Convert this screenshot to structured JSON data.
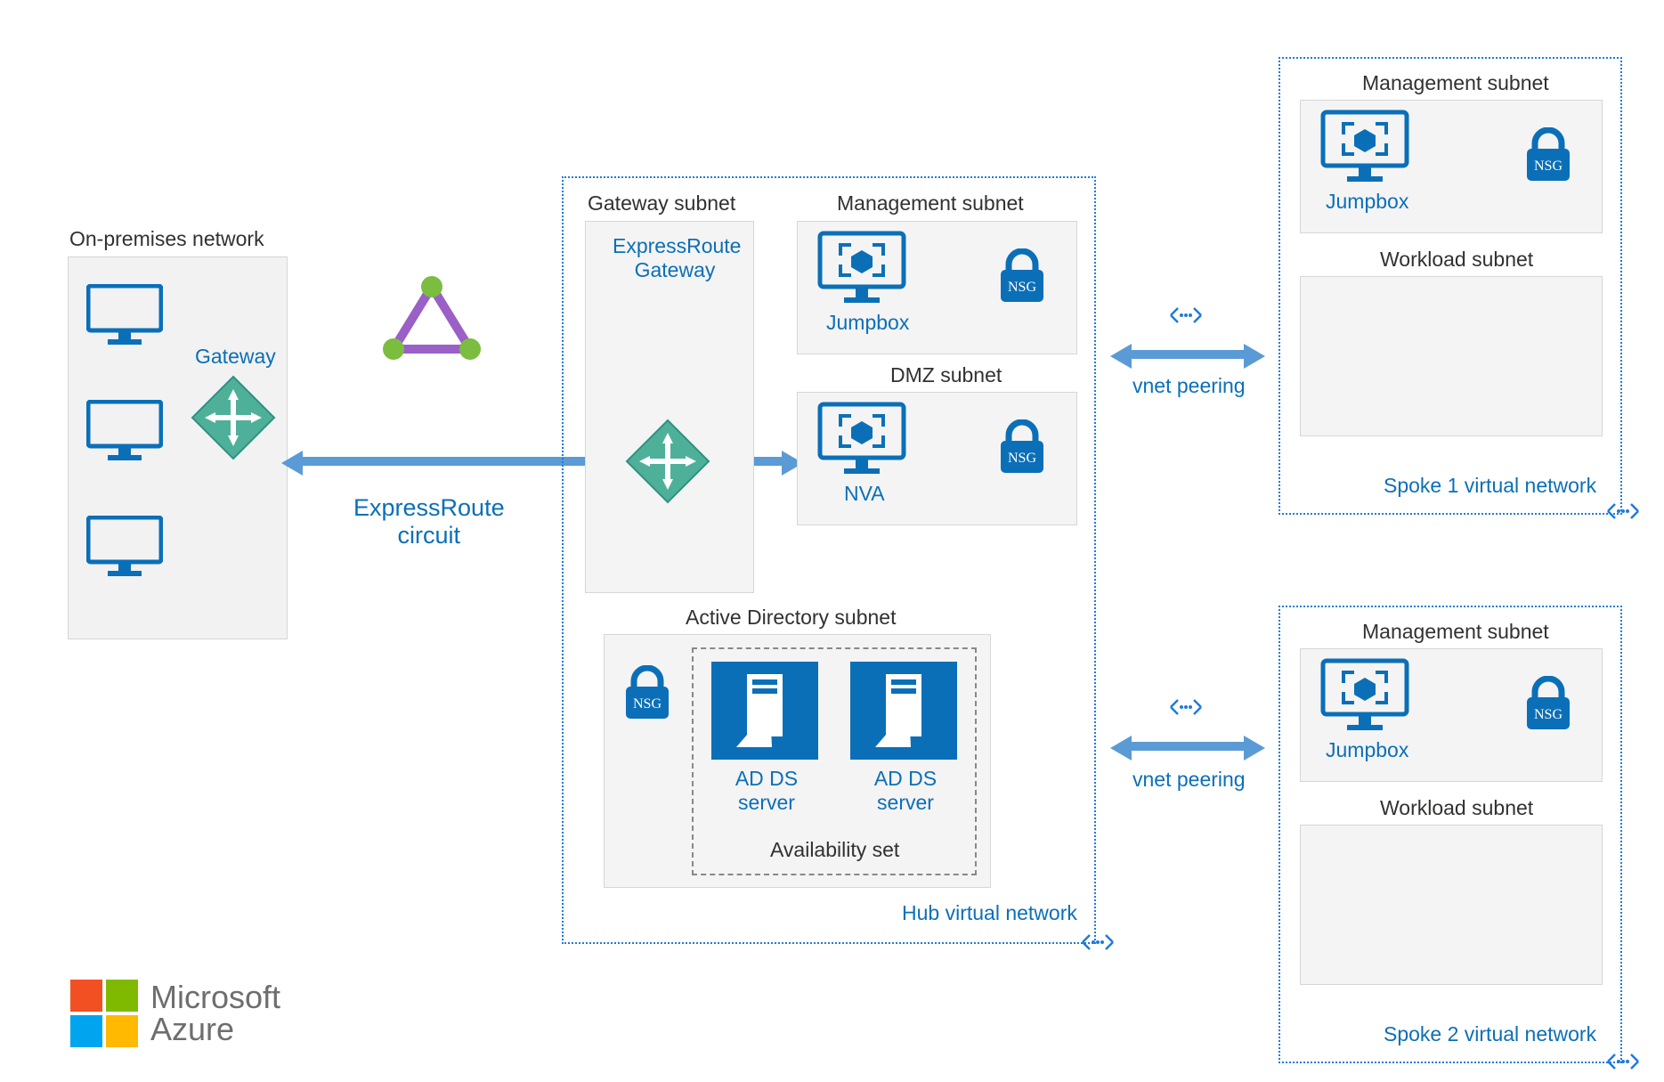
{
  "onprem": {
    "title": "On-premises network",
    "gateway": "Gateway"
  },
  "expressroute_circuit": "ExpressRoute\ncircuit",
  "hub": {
    "gateway_subnet": "Gateway subnet",
    "expressroute_gateway": "ExpressRoute Gateway",
    "mgmt_subnet": "Management subnet",
    "jumpbox": "Jumpbox",
    "dmz_subnet": "DMZ subnet",
    "nva": "NVA",
    "ad_subnet": "Active Directory subnet",
    "ad_ds": "AD DS server",
    "avset": "Availability set",
    "label": "Hub virtual network"
  },
  "nsg": "NSG",
  "spoke1": {
    "mgmt": "Management subnet",
    "jumpbox": "Jumpbox",
    "workload": "Workload subnet",
    "label": "Spoke 1 virtual network"
  },
  "spoke2": {
    "mgmt": "Management subnet",
    "jumpbox": "Jumpbox",
    "workload": "Workload subnet",
    "label": "Spoke 2 virtual network"
  },
  "vnet_peering": "vnet peering",
  "brand": {
    "name": "Microsoft",
    "product": "Azure"
  }
}
